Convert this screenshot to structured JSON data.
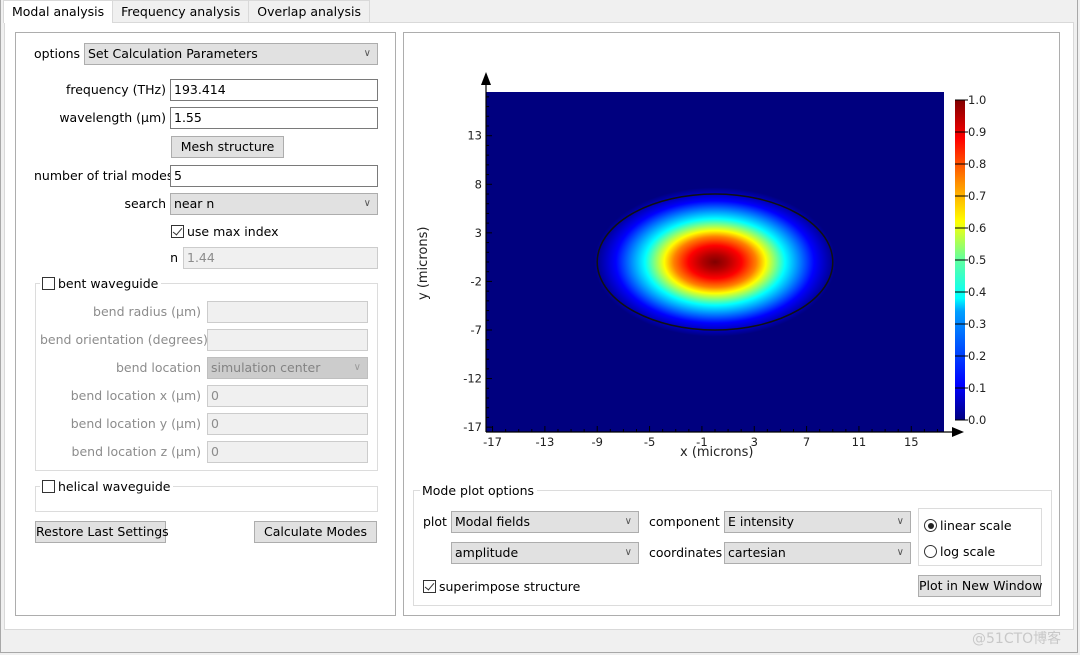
{
  "tabs": [
    {
      "label": "Modal analysis",
      "active": true
    },
    {
      "label": "Frequency analysis",
      "active": false
    },
    {
      "label": "Overlap analysis",
      "active": false
    }
  ],
  "left": {
    "options": {
      "label": "options",
      "value": "Set Calculation Parameters"
    },
    "frequency": {
      "label": "frequency (THz)",
      "value": "193.414"
    },
    "wavelength": {
      "label": "wavelength (µm)",
      "value": "1.55"
    },
    "mesh_button": "Mesh structure",
    "trial_modes": {
      "label": "number of trial modes",
      "value": "5"
    },
    "search": {
      "label": "search",
      "value": "near n"
    },
    "use_max_index": {
      "label": "use max index",
      "checked": true
    },
    "n": {
      "label": "n",
      "value": "1.44"
    },
    "bent": {
      "label": "bent waveguide",
      "checked": false,
      "radius": {
        "label": "bend radius (µm)",
        "value": ""
      },
      "orientation": {
        "label": "bend orientation (degrees)",
        "value": ""
      },
      "location": {
        "label": "bend location",
        "value": "simulation center"
      },
      "loc_x": {
        "label": "bend location x (µm)",
        "value": "0"
      },
      "loc_y": {
        "label": "bend location y (µm)",
        "value": "0"
      },
      "loc_z": {
        "label": "bend location z (µm)",
        "value": "0"
      }
    },
    "helical": {
      "label": "helical waveguide",
      "checked": false
    },
    "restore_button": "Restore Last Settings",
    "calculate_button": "Calculate Modes"
  },
  "plot_options": {
    "title": "Mode plot options",
    "plot": {
      "label": "plot",
      "value": "Modal fields"
    },
    "plot2": {
      "value": "amplitude"
    },
    "component": {
      "label": "component",
      "value": "E intensity"
    },
    "coordinates": {
      "label": "coordinates",
      "value": "cartesian"
    },
    "superimpose": {
      "label": "superimpose structure",
      "checked": true
    },
    "linear_scale": {
      "label": "linear scale",
      "selected": true
    },
    "log_scale": {
      "label": "log scale",
      "selected": false
    },
    "new_window_button": "Plot in New Window"
  },
  "icons": {
    "chevron": "∨"
  },
  "watermark": "@51CTO博客",
  "chart_data": {
    "type": "heatmap",
    "title": "",
    "xlabel": "x (microns)",
    "ylabel": "y (microns)",
    "xlim": [
      -17.5,
      17.5
    ],
    "ylim": [
      -17.5,
      17.5
    ],
    "x_ticks": [
      -17,
      -13,
      -9,
      -5,
      -1,
      3,
      7,
      11,
      15
    ],
    "y_ticks": [
      -17,
      -12,
      -7,
      -2,
      3,
      8,
      13
    ],
    "colorbar": {
      "range": [
        0.0,
        1.0
      ],
      "ticks": [
        "0.0",
        "0.1",
        "0.2",
        "0.3",
        "0.4",
        "0.5",
        "0.6",
        "0.7",
        "0.8",
        "0.9",
        "1.0"
      ],
      "colormap": "jet"
    },
    "field": {
      "description": "Gaussian-like fundamental mode E intensity",
      "peak_value": 1.0,
      "center": [
        0.0,
        0.0
      ],
      "sigma_x": 4.2,
      "sigma_y": 3.2
    },
    "structure_outline": {
      "shape": "ellipse",
      "center": [
        0.0,
        0.0
      ],
      "semi_axis_x": 9.0,
      "semi_axis_y": 7.0
    },
    "background_color": "#00007f"
  }
}
